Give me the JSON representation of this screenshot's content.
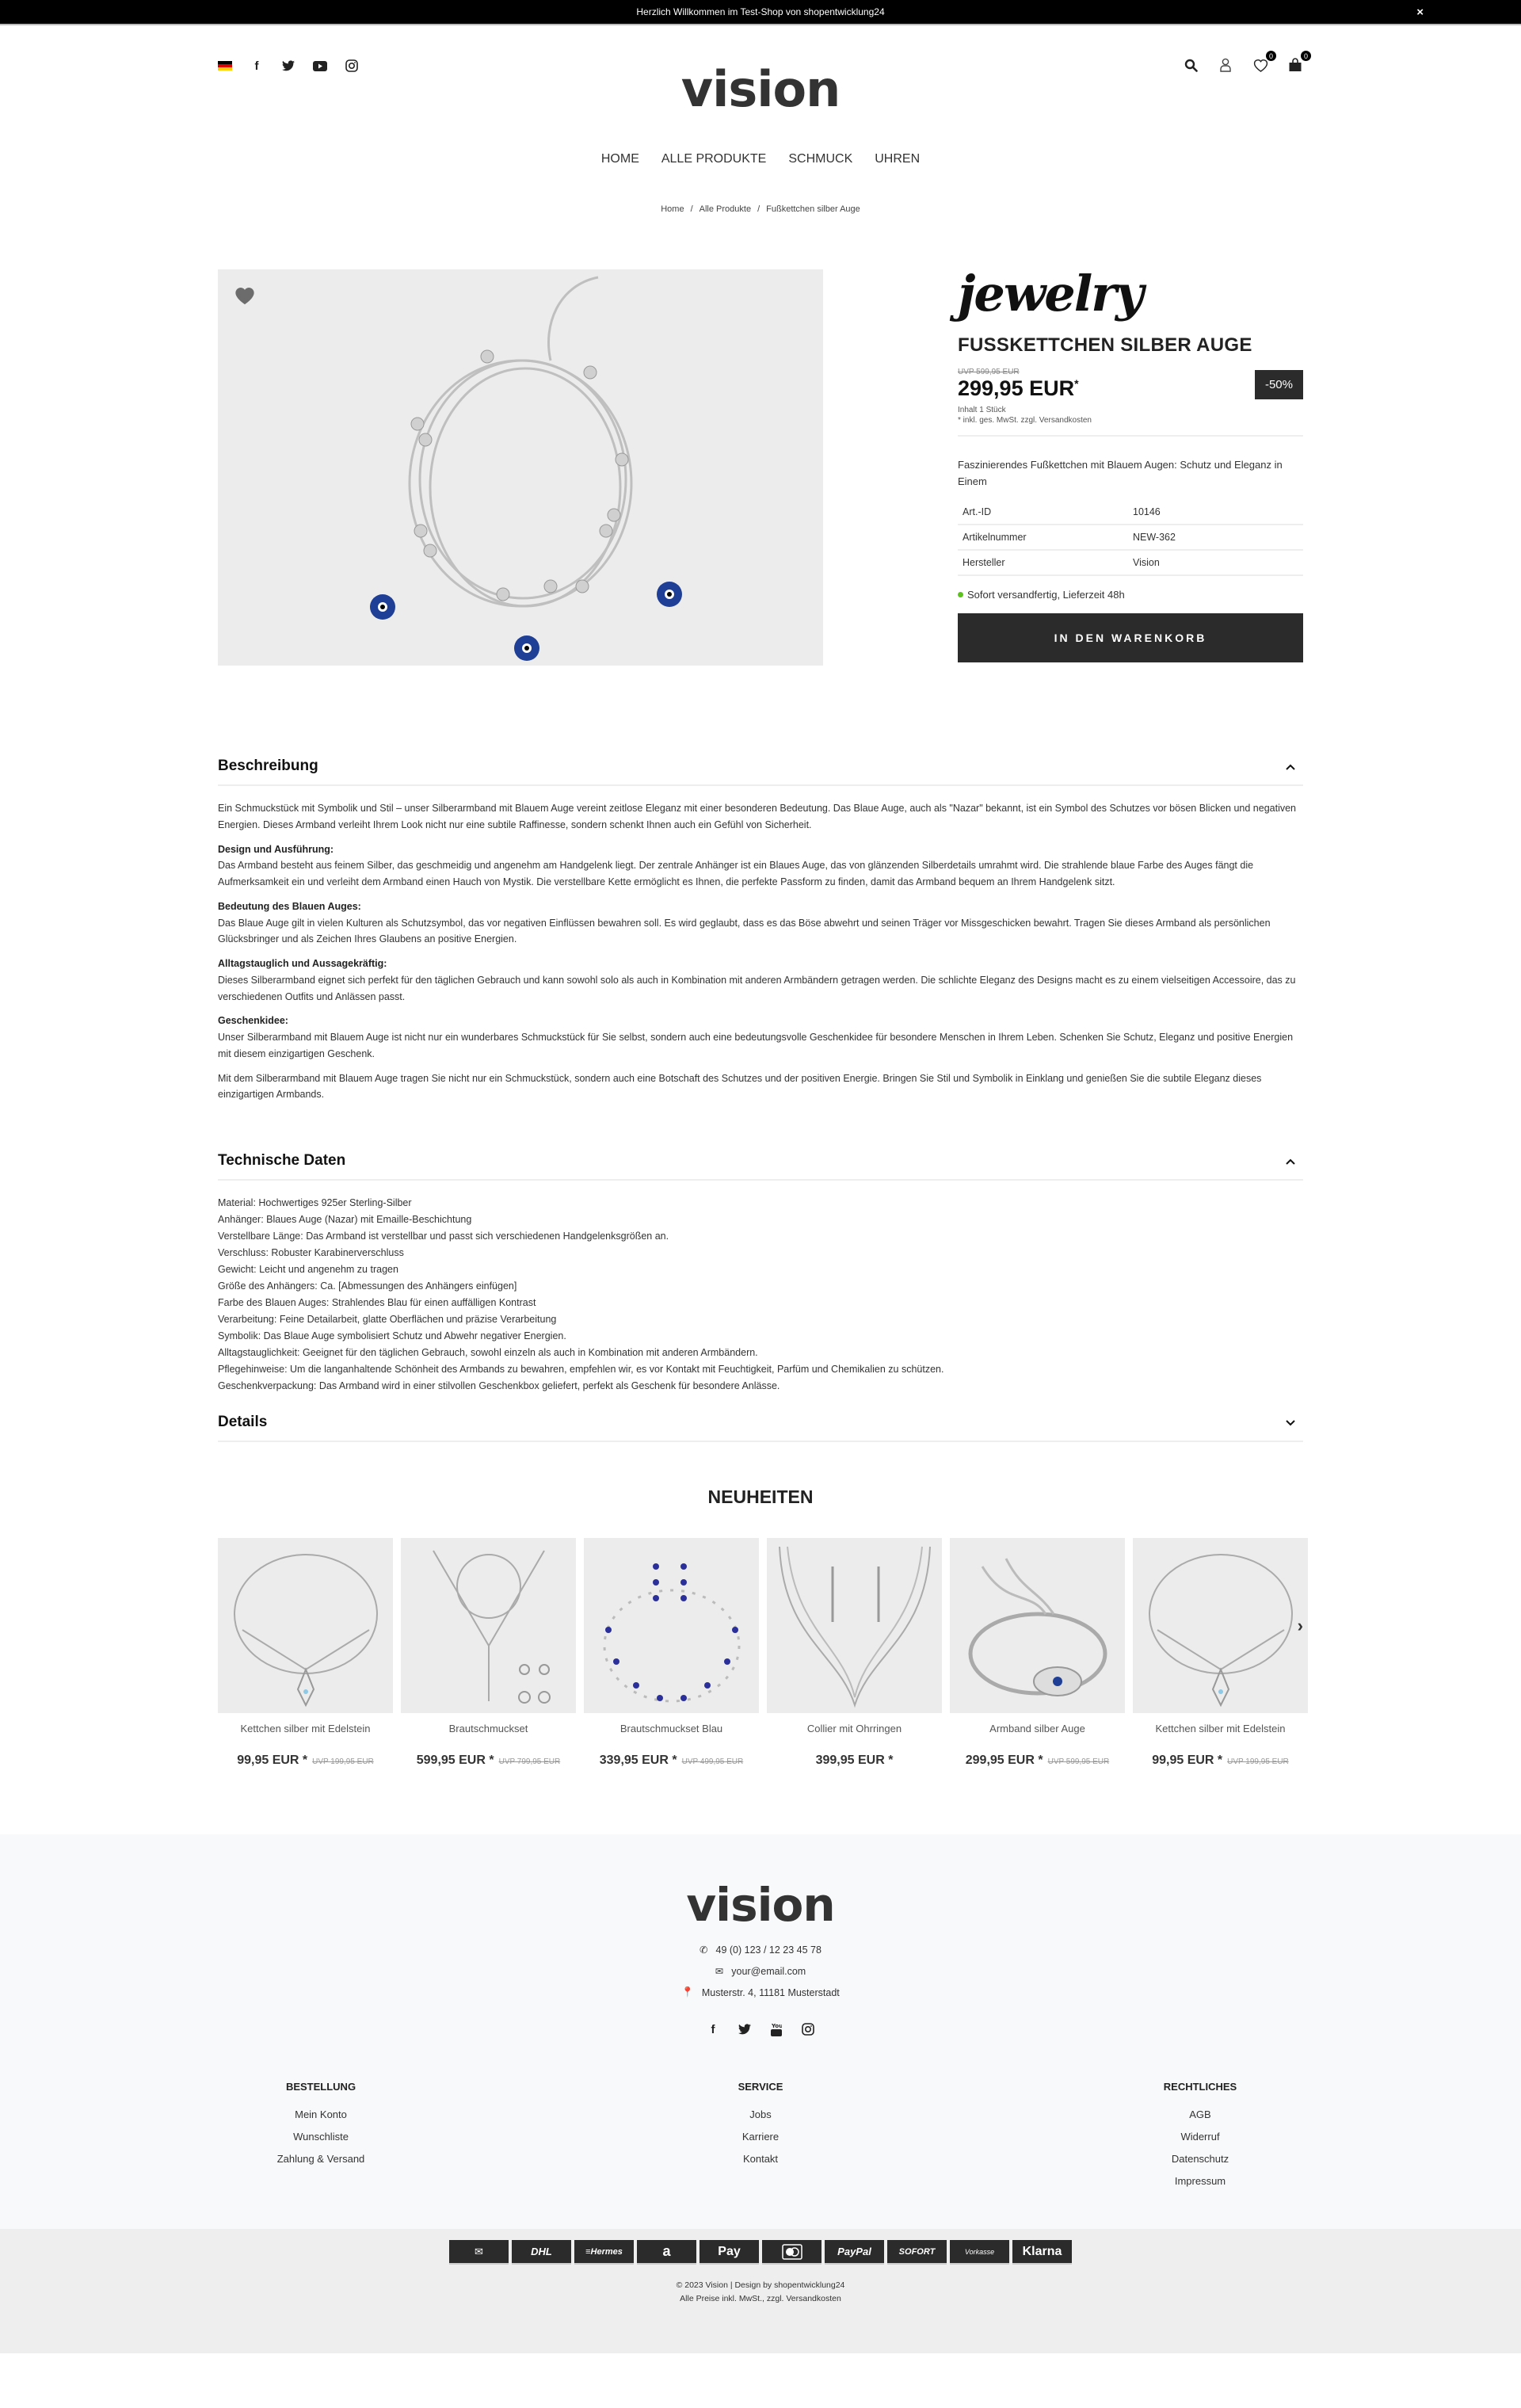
{
  "topbar": {
    "message": "Herzlich Willkommen im Test-Shop von shopentwicklung24",
    "close": "×"
  },
  "header": {
    "logo": "vision",
    "wishlist_count": "0",
    "cart_count": "0"
  },
  "nav": [
    {
      "label": "HOME"
    },
    {
      "label": "ALLE PRODUKTE"
    },
    {
      "label": "SCHMUCK"
    },
    {
      "label": "UHREN"
    }
  ],
  "breadcrumb": [
    {
      "label": "Home"
    },
    {
      "label": "Alle Produkte"
    },
    {
      "label": "Fußkettchen silber Auge"
    }
  ],
  "product": {
    "brand": "jewelry",
    "title": "FUSSKETTCHEN SILBER AUGE",
    "uvp": "UVP 599,95 EUR",
    "price": "299,95 EUR",
    "price_mark": "*",
    "discount": "-50%",
    "content": "Inhalt 1 Stück",
    "tax_note": "* inkl. ges. MwSt. zzgl. Versandkosten",
    "short_description": "Faszinierendes Fußkettchen mit Blauem Augen: Schutz und Eleganz in Einem",
    "attributes": [
      {
        "label": "Art.-ID",
        "value": "10146"
      },
      {
        "label": "Artikelnummer",
        "value": "NEW-362"
      },
      {
        "label": "Hersteller",
        "value": "Vision"
      }
    ],
    "stock": "Sofort versandfertig, Lieferzeit 48h",
    "stock_color": "#5fc021",
    "cart_button": "IN DEN WARENKORB"
  },
  "description": {
    "title": "Beschreibung",
    "intro": "Ein Schmuckstück mit Symbolik und Stil – unser Silberarmband mit Blauem Auge vereint zeitlose Eleganz mit einer besonderen Bedeutung. Das Blaue Auge, auch als \"Nazar\" bekannt, ist ein Symbol des Schutzes vor bösen Blicken und negativen Energien. Dieses Armband verleiht Ihrem Look nicht nur eine subtile Raffinesse, sondern schenkt Ihnen auch ein Gefühl von Sicherheit.",
    "sections": [
      {
        "heading": "Design und Ausführung:",
        "text": "Das Armband besteht aus feinem Silber, das geschmeidig und angenehm am Handgelenk liegt. Der zentrale Anhänger ist ein Blaues Auge, das von glänzenden Silberdetails umrahmt wird. Die strahlende blaue Farbe des Auges fängt die Aufmerksamkeit ein und verleiht dem Armband einen Hauch von Mystik. Die verstellbare Kette ermöglicht es Ihnen, die perfekte Passform zu finden, damit das Armband bequem an Ihrem Handgelenk sitzt."
      },
      {
        "heading": "Bedeutung des Blauen Auges:",
        "text": "Das Blaue Auge gilt in vielen Kulturen als Schutzsymbol, das vor negativen Einflüssen bewahren soll. Es wird geglaubt, dass es das Böse abwehrt und seinen Träger vor Missgeschicken bewahrt. Tragen Sie dieses Armband als persönlichen Glücksbringer und als Zeichen Ihres Glaubens an positive Energien."
      },
      {
        "heading": "Alltagstauglich und Aussagekräftig:",
        "text": "Dieses Silberarmband eignet sich perfekt für den täglichen Gebrauch und kann sowohl solo als auch in Kombination mit anderen Armbändern getragen werden. Die schlichte Eleganz des Designs macht es zu einem vielseitigen Accessoire, das zu verschiedenen Outfits und Anlässen passt."
      },
      {
        "heading": "Geschenkidee:",
        "text": "Unser Silberarmband mit Blauem Auge ist nicht nur ein wunderbares Schmuckstück für Sie selbst, sondern auch eine bedeutungsvolle Geschenkidee für besondere Menschen in Ihrem Leben. Schenken Sie Schutz, Eleganz und positive Energien mit diesem einzigartigen Geschenk."
      }
    ],
    "outro": "Mit dem Silberarmband mit Blauem Auge tragen Sie nicht nur ein Schmuckstück, sondern auch eine Botschaft des Schutzes und der positiven Energie. Bringen Sie Stil und Symbolik in Einklang und genießen Sie die subtile Eleganz dieses einzigartigen Armbands."
  },
  "technical": {
    "title": "Technische Daten",
    "lines": [
      "Material: Hochwertiges 925er Sterling-Silber",
      "Anhänger: Blaues Auge (Nazar) mit Emaille-Beschichtung",
      "Verstellbare Länge: Das Armband ist verstellbar und passt sich verschiedenen Handgelenksgrößen an.",
      "Verschluss: Robuster Karabinerverschluss",
      "Gewicht: Leicht und angenehm zu tragen",
      "Größe des Anhängers: Ca. [Abmessungen des Anhängers einfügen]",
      "Farbe des Blauen Auges: Strahlendes Blau für einen auffälligen Kontrast",
      "Verarbeitung: Feine Detailarbeit, glatte Oberflächen und präzise Verarbeitung",
      "Symbolik: Das Blaue Auge symbolisiert Schutz und Abwehr negativer Energien.",
      "Alltagstauglichkeit: Geeignet für den täglichen Gebrauch, sowohl einzeln als auch in Kombination mit anderen Armbändern.",
      "Pflegehinweise: Um die langanhaltende Schönheit des Armbands zu bewahren, empfehlen wir, es vor Kontakt mit Feuchtigkeit, Parfüm und Chemikalien zu schützen.",
      "Geschenkverpackung: Das Armband wird in einer stilvollen Geschenkbox geliefert, perfekt als Geschenk für besondere Anlässe."
    ]
  },
  "details": {
    "title": "Details"
  },
  "news": {
    "title": "NEUHEITEN",
    "items": [
      {
        "name": "Kettchen silber mit Edelstein",
        "price": "99,95 EUR *",
        "uvp": "UVP 199,95 EUR"
      },
      {
        "name": "Brautschmuckset",
        "price": "599,95 EUR *",
        "uvp": "UVP 799,95 EUR"
      },
      {
        "name": "Brautschmuckset Blau",
        "price": "339,95 EUR *",
        "uvp": "UVP 499,95 EUR"
      },
      {
        "name": "Collier mit Ohrringen",
        "price": "399,95 EUR *",
        "uvp": ""
      },
      {
        "name": "Armband silber Auge",
        "price": "299,95 EUR *",
        "uvp": "UVP 599,95 EUR"
      },
      {
        "name": "Kettchen silber mit Edelstein",
        "price": "99,95 EUR *",
        "uvp": "UVP 199,95 EUR"
      }
    ]
  },
  "footer": {
    "logo": "vision",
    "phone": "49 (0) 123 / 12 23 45 78",
    "email": "your@email.com",
    "address": "Musterstr. 4, 11181 Musterstadt",
    "columns": [
      {
        "title": "BESTELLUNG",
        "links": [
          "Mein Konto",
          "Wunschliste",
          "Zahlung & Versand"
        ]
      },
      {
        "title": "SERVICE",
        "links": [
          "Jobs",
          "Karriere",
          "Kontakt"
        ]
      },
      {
        "title": "RECHTLICHES",
        "links": [
          "AGB",
          "Widerruf",
          "Datenschutz",
          "Impressum"
        ]
      }
    ],
    "payments": [
      "Deutsche Post",
      "DHL",
      "Hermes",
      "Amazon",
      "Apple Pay",
      "Mastercard",
      "PayPal",
      "SOFORT",
      "Vorkasse",
      "Klarna"
    ],
    "copyright": "© 2023 Vision | Design by shopentwicklung24",
    "price_note": "Alle Preise inkl. MwSt., zzgl. Versandkosten"
  }
}
